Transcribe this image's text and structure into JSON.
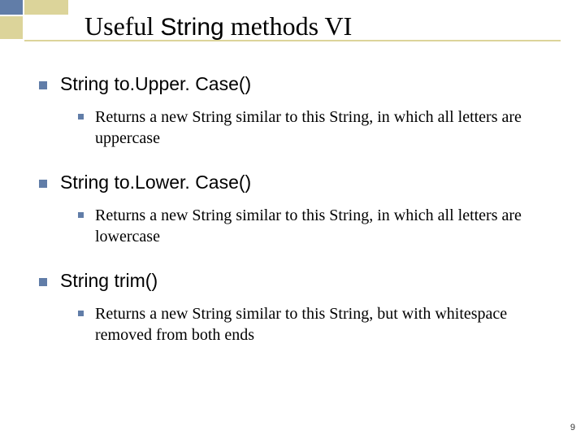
{
  "title": {
    "pre": "Useful ",
    "code": "String",
    "post": " methods VI"
  },
  "items": [
    {
      "heading": "String to.Upper. Case()",
      "sub": "Returns a new String similar to this String, in which all letters are uppercase"
    },
    {
      "heading": "String to.Lower. Case()",
      "sub": "Returns a new String similar to this String, in which all letters are lowercase"
    },
    {
      "heading": "String trim()",
      "sub": "Returns a new String similar to this String, but with whitespace removed from both ends"
    }
  ],
  "page_number": "9"
}
